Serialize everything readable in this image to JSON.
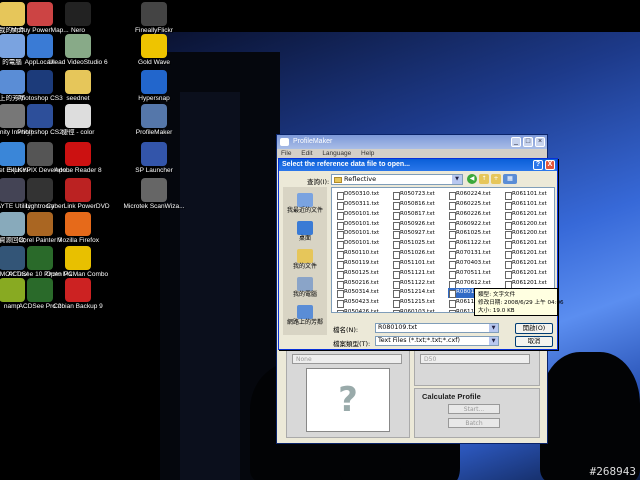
{
  "desktop": {
    "icons": [
      {
        "label": "我的文件",
        "icon": "folder-icon",
        "color": "#e6c65a"
      },
      {
        "label": "Mcbuy PowerMap...",
        "icon": "app-icon",
        "color": "#c44"
      },
      {
        "label": "Nero",
        "icon": "app-icon",
        "color": "#222"
      },
      {
        "label": "FineallyFlickr",
        "icon": "app-icon",
        "color": "#444"
      },
      {
        "label": "的電腦",
        "icon": "computer-icon",
        "color": "#7aa3e0"
      },
      {
        "label": "AppLocale",
        "icon": "globe-icon",
        "color": "#3a7bd5"
      },
      {
        "label": "Ulead VideoStudio 6",
        "icon": "film-icon",
        "color": "#8a8"
      },
      {
        "label": "Gold Wave",
        "icon": "wave-icon",
        "color": "#eec400"
      },
      {
        "label": "上的芳鄰",
        "icon": "network-icon",
        "color": "#5a8dd6"
      },
      {
        "label": "Photoshop CS3",
        "icon": "photoshop-icon",
        "color": "#1c3b7a"
      },
      {
        "label": "seednet",
        "icon": "folder-icon",
        "color": "#e6c65a"
      },
      {
        "label": "Hypersnap",
        "icon": "camera-icon",
        "color": "#2266cc"
      },
      {
        "label": "Infinity Infinity)",
        "icon": "app-icon",
        "color": "#777"
      },
      {
        "label": "Photoshop CS2",
        "icon": "photoshop-icon",
        "color": "#2d4f9a"
      },
      {
        "label": "捷徑 - color",
        "icon": "shortcut-icon",
        "color": "#ddd"
      },
      {
        "label": "ProfileMaker",
        "icon": "profilemaker-icon",
        "color": "#5577aa"
      },
      {
        "label": "rnet Explorer",
        "icon": "ie-icon",
        "color": "#3a86d8"
      },
      {
        "label": "SILKYPIX Develope...",
        "icon": "app-icon",
        "color": "#555"
      },
      {
        "label": "Adobe Reader 8",
        "icon": "pdf-icon",
        "color": "#c11"
      },
      {
        "label": "SP Launcher",
        "icon": "launcher-icon",
        "color": "#3355aa"
      },
      {
        "label": "LAYTE Utility",
        "icon": "app-icon",
        "color": "#445"
      },
      {
        "label": "Lightroom",
        "icon": "lightroom-icon",
        "color": "#333"
      },
      {
        "label": "CyberLink PowerDVD",
        "icon": "dvd-icon",
        "color": "#b22"
      },
      {
        "label": "Microtek ScanWiza...",
        "icon": "scanner-icon",
        "color": "#666"
      },
      {
        "label": "資源回收",
        "icon": "recycle-bin-icon",
        "color": "#8ab"
      },
      {
        "label": "Corel Painter 8",
        "icon": "painter-icon",
        "color": "#aa6622"
      },
      {
        "label": "Mozilla Firefox",
        "icon": "firefox-icon",
        "color": "#e66a1a"
      },
      {
        "label": "EMON Tool",
        "icon": "app-icon",
        "color": "#357"
      },
      {
        "label": "ACDSee 10 Photo Manager",
        "icon": "acdsee-icon",
        "color": "#2a6a2a"
      },
      {
        "label": "Open PCMan Combo 2007",
        "icon": "pcman-icon",
        "color": "#e8c000"
      },
      {
        "label": "namp",
        "icon": "app-icon",
        "color": "#8a2"
      },
      {
        "label": "ACDSee Pro 2",
        "icon": "acdsee-icon",
        "color": "#2a6a2a"
      },
      {
        "label": "Cobian Backup 9",
        "icon": "backup-icon",
        "color": "#c22"
      }
    ],
    "watermark": "#268943"
  },
  "profilemaker": {
    "title": "ProfileMaker",
    "menu": [
      "File",
      "Edit",
      "Language",
      "Help"
    ],
    "select_left": "None",
    "select_right": "D50",
    "calculate_title": "Calculate Profile",
    "start_label": "Start...",
    "batch_label": "Batch"
  },
  "dialog": {
    "title": "Select the reference data file to open...",
    "lookin_label": "查詢(I):",
    "lookin_value": "Reflective",
    "places": [
      "我最近的文件",
      "桌面",
      "我的文件",
      "我的電腦",
      "網路上的芳鄰"
    ],
    "files": [
      [
        "D050310.txt",
        "D050311.txt",
        "D050101.txt",
        "D050101.txt",
        "D050101.txt",
        "D050101.txt",
        "R050110.txt",
        "R050119.txt",
        "R050125.txt",
        "R050216.txt",
        "R050314.txt",
        "R050423.txt",
        "R050426.txt",
        "R050722.txt"
      ],
      [
        "R050723.txt",
        "R050816.txt",
        "R050817.txt",
        "R050926.txt",
        "R050927.txt",
        "R051025.txt",
        "R051026.txt",
        "R051101.txt",
        "R051121.txt",
        "R051122.txt",
        "R051214.txt",
        "R051215.txt",
        "R060103.txt",
        "R060223.txt"
      ],
      [
        "R060224.txt",
        "R060225.txt",
        "R060226.txt",
        "R060922.txt",
        "R061025.txt",
        "R061122.txt",
        "R070131.txt",
        "R070403.txt",
        "R070511.txt",
        "R070612.txt",
        "R080109.txt",
        "R061101.txt",
        "R061101.txt",
        "R061101.txt"
      ],
      [
        "R061101.txt",
        "R061101.txt",
        "R061201.txt",
        "R061200.txt",
        "R061200.txt",
        "R061201.txt",
        "R061201.txt",
        "R061201.txt",
        "R061201.txt",
        "R061201.txt",
        "R061201.txt",
        "",
        "",
        ""
      ]
    ],
    "selected_file": "R080109.txt",
    "tooltip": {
      "type": "類型: 文字文件",
      "modified": "修改日期: 2008/6/29 上午 04:06",
      "size": "大小: 19.0 KB"
    },
    "filename_label": "檔名(N):",
    "filename_value": "R080109.txt",
    "filetype_label": "檔案類型(T):",
    "filetype_value": "Text Files (*.txt;*.txt;*.cxf)",
    "open_label": "開啟(O)",
    "cancel_label": "取消",
    "help_label": "?",
    "close_label": "X"
  }
}
